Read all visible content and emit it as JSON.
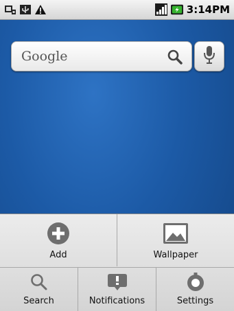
{
  "status_bar": {
    "time": "3:14PM",
    "left_icons": [
      "usb-debug-icon",
      "usb-icon",
      "warning-icon"
    ],
    "right_icons": [
      "signal-icon",
      "battery-charging-icon"
    ]
  },
  "search_widget": {
    "label": "Google",
    "icons": [
      "search-icon",
      "microphone-icon"
    ]
  },
  "menu": {
    "row1": [
      {
        "label": "Add",
        "icon": "add-icon"
      },
      {
        "label": "Wallpaper",
        "icon": "wallpaper-icon"
      }
    ],
    "row2": [
      {
        "label": "Search",
        "icon": "search-icon"
      },
      {
        "label": "Notifications",
        "icon": "notifications-icon"
      },
      {
        "label": "Settings",
        "icon": "settings-icon"
      }
    ]
  },
  "colors": {
    "wallpaper": "#1c5aa6",
    "menu_bg": "#e2e2e2",
    "icon_gray": "#6e6e6e"
  }
}
